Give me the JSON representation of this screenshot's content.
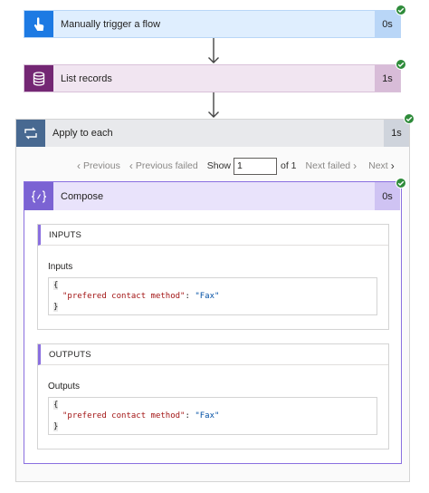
{
  "trigger": {
    "title": "Manually trigger a flow",
    "duration": "0s",
    "icon": "touch-hand-icon"
  },
  "list_records": {
    "title": "List records",
    "duration": "1s",
    "icon": "database-icon"
  },
  "apply_to_each": {
    "title": "Apply to each",
    "duration": "1s",
    "icon": "loop-icon"
  },
  "pager": {
    "previous": "Previous",
    "previous_failed": "Previous failed",
    "show_label": "Show",
    "current_page": "1",
    "of_label": "of 1",
    "next_failed": "Next failed",
    "next": "Next"
  },
  "compose": {
    "title": "Compose",
    "duration": "0s",
    "icon": "curly-braces-icon",
    "inputs": {
      "section_title": "INPUTS",
      "label": "Inputs",
      "open_brace": "{",
      "key": "\"prefered contact method\"",
      "colon": ": ",
      "value": "\"Fax\"",
      "close_brace": "}"
    },
    "outputs": {
      "section_title": "OUTPUTS",
      "label": "Outputs",
      "open_brace": "{",
      "key": "\"prefered contact method\"",
      "colon": ": ",
      "value": "\"Fax\"",
      "close_brace": "}"
    }
  },
  "colors": {
    "success": "#2e8b3a",
    "trigger_accent": "#1d7ae3",
    "dataverse_accent": "#742774",
    "loop_accent": "#486991",
    "compose_accent": "#7b63d3"
  }
}
